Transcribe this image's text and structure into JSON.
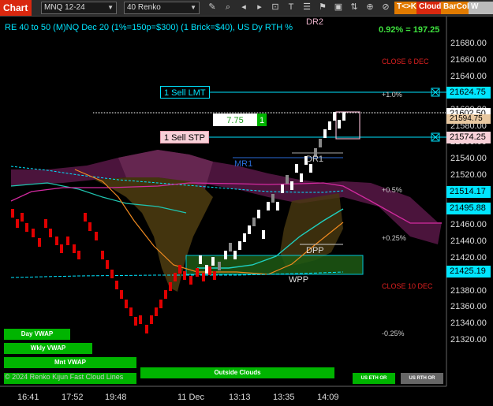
{
  "toolbar": {
    "tab_label": "Chart",
    "instrument": "MNQ 12-24",
    "bar_type": "40 Renko",
    "btn_tk": "T<>K",
    "btn_cloud": "Cloud",
    "btn_barcol": "BarCol",
    "btn_w": "W VWAP",
    "icons": [
      "chevron-down-icon",
      "pencil-icon",
      "magnify-icon",
      "arrow-left-icon",
      "arrow-right-icon",
      "drawing-icon",
      "text-icon",
      "properties-icon",
      "alert-icon",
      "screenshot-icon",
      "trade-icon",
      "lock-icon",
      "lock-icon"
    ]
  },
  "info": {
    "title": "RE 40 to 50 (M)NQ Dec 20 (1%=150p=$300) (1 Brick=$40), US Dy RTH %",
    "pct": "0.92% = 197.25"
  },
  "price_axis": {
    "ticks": [
      "21680.00",
      "21660.00",
      "21640.00",
      "21620.00",
      "21600.00",
      "21580.00",
      "21560.00",
      "21540.00",
      "21520.00",
      "21500.00",
      "21480.00",
      "21460.00",
      "21440.00",
      "21420.00",
      "21400.00",
      "21380.00",
      "21360.00",
      "21340.00",
      "21320.00"
    ]
  },
  "time_axis": {
    "ticks": [
      "16:41",
      "17:52",
      "19:48",
      "11 Dec",
      "13:13",
      "13:35",
      "14:09"
    ]
  },
  "price_tags": {
    "sell_lmt": "21624.75",
    "last": "21602.50",
    "mid": "21594.75",
    "sell_stp": "21574.25",
    "mid2": "21514.17",
    "mid3": "21495.88",
    "low": "21425.19"
  },
  "orders": {
    "sell_lmt_label": "1 Sell LMT",
    "sell_stp_label": "1 Sell STP",
    "qty_price": "7.75",
    "qty": "1"
  },
  "annotations": {
    "dr2": "DR2",
    "close6": "CLOSE 6 DEC",
    "p10": "+1.0%",
    "mr1": "MR1",
    "dr1": "DR1",
    "p05": "+0.5%",
    "p025": "+0.25%",
    "dpp": "DPP",
    "wpp": "WPP",
    "close10": "CLOSE 10 DEC",
    "m025": "-0.25%"
  },
  "buttons": {
    "day_vwap": "Day VWAP",
    "wkly_vwap": "Wkly VWAP",
    "mnt_vwap": "Mnt VWAP",
    "outside_clouds": "Outside Clouds",
    "us_eth": "US ETH OR",
    "us_rth": "US RTH OR"
  },
  "footer": {
    "copyright": "© 2024 Renko Kijun Fast Cloud Lines"
  },
  "colors": {
    "accent": "#00e5ff",
    "up": "#ffffff",
    "down": "#e00000",
    "green": "#00b400"
  }
}
